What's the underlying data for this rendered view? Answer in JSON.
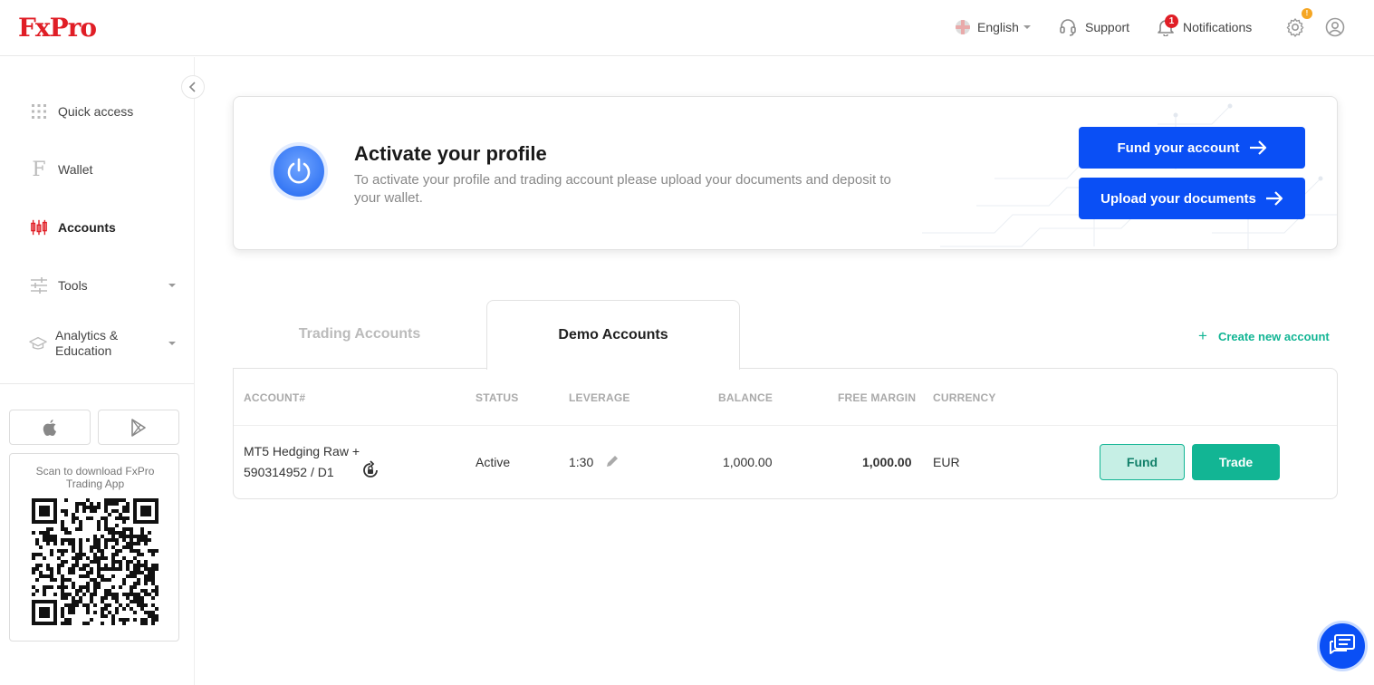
{
  "header": {
    "logo": "FxPro",
    "language": "English",
    "support": "Support",
    "notifications": "Notifications",
    "notifications_count": "1",
    "settings_badge": "!"
  },
  "sidebar": {
    "items": [
      {
        "label": "Quick access",
        "icon": "grid-icon"
      },
      {
        "label": "Wallet",
        "icon": "wallet-f-icon"
      },
      {
        "label": "Accounts",
        "icon": "candles-icon",
        "active": true
      },
      {
        "label": "Tools",
        "icon": "sliders-icon"
      },
      {
        "label": "Analytics &\nEducation",
        "icon": "graduation-cap-icon"
      }
    ],
    "qr_text": "Scan to download FxPro Trading App"
  },
  "banner": {
    "title": "Activate your profile",
    "description": "To activate your profile and trading account please upload your documents and deposit to your wallet.",
    "fund_button": "Fund your account",
    "upload_button": "Upload your documents"
  },
  "tabs": [
    "Trading Accounts",
    "Demo Accounts"
  ],
  "create_account": "Create new account",
  "table": {
    "columns": [
      "ACCOUNT#",
      "STATUS",
      "LEVERAGE",
      "BALANCE",
      "FREE MARGIN",
      "CURRENCY"
    ],
    "rows": [
      {
        "account_line1": "MT5 Hedging Raw +",
        "account_line2": "590314952 / D1",
        "status": "Active",
        "leverage": "1:30",
        "balance": "1,000.00",
        "free_margin": "1,000.00",
        "currency": "EUR",
        "fund": "Fund",
        "trade": "Trade"
      }
    ]
  },
  "colors": {
    "brand_red": "#e01e26",
    "primary_blue": "#0a4ff5",
    "accent_green": "#12b594"
  }
}
